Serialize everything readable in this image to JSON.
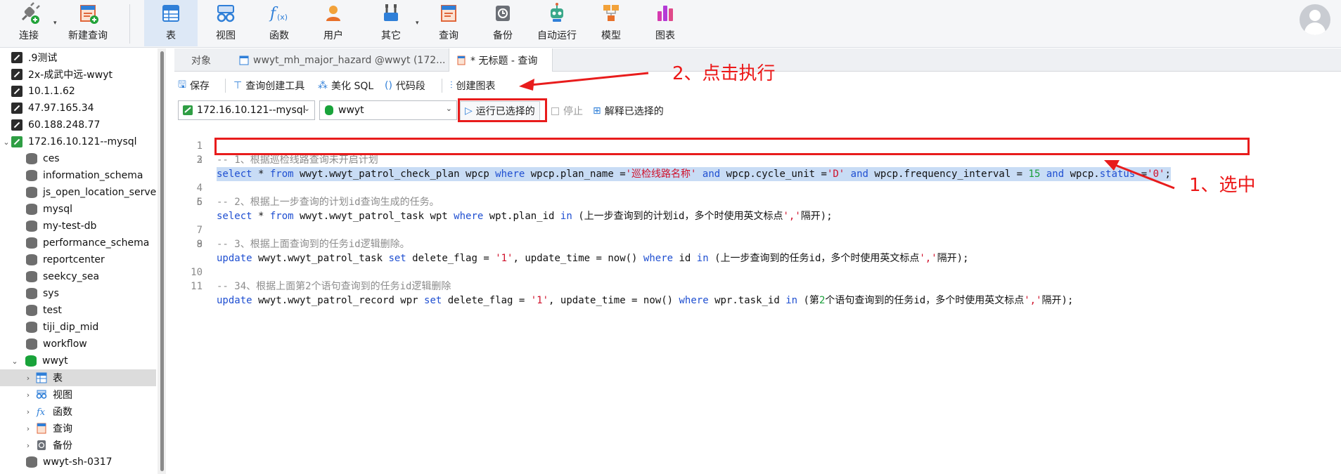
{
  "toolbar": {
    "items": [
      {
        "id": "connect",
        "label": "连接",
        "icon": "plug-icon"
      },
      {
        "id": "new-query",
        "label": "新建查询",
        "icon": "new-query-icon"
      },
      {
        "id": "table",
        "label": "表",
        "icon": "table-icon",
        "active": true
      },
      {
        "id": "view",
        "label": "视图",
        "icon": "glasses-icon"
      },
      {
        "id": "function",
        "label": "函数",
        "icon": "function-icon"
      },
      {
        "id": "user",
        "label": "用户",
        "icon": "user-icon"
      },
      {
        "id": "other",
        "label": "其它",
        "icon": "tools-icon"
      },
      {
        "id": "query",
        "label": "查询",
        "icon": "query-icon"
      },
      {
        "id": "backup",
        "label": "备份",
        "icon": "backup-icon"
      },
      {
        "id": "automation",
        "label": "自动运行",
        "icon": "robot-icon"
      },
      {
        "id": "model",
        "label": "模型",
        "icon": "model-icon"
      },
      {
        "id": "chart",
        "label": "图表",
        "icon": "chart-icon"
      }
    ]
  },
  "sidebar": {
    "items": [
      {
        "label": ".9测试",
        "type": "connection"
      },
      {
        "label": "2x-成武中远-wwyt",
        "type": "connection"
      },
      {
        "label": "10.1.1.62",
        "type": "connection"
      },
      {
        "label": "47.97.165.34",
        "type": "connection"
      },
      {
        "label": "60.188.248.77",
        "type": "connection"
      },
      {
        "label": "172.16.10.121--mysql",
        "type": "connection-open",
        "caret": "⌄"
      },
      {
        "label": "ces",
        "type": "database"
      },
      {
        "label": "information_schema",
        "type": "database"
      },
      {
        "label": "js_open_location_server",
        "type": "database"
      },
      {
        "label": "mysql",
        "type": "database"
      },
      {
        "label": "my-test-db",
        "type": "database"
      },
      {
        "label": "performance_schema",
        "type": "database"
      },
      {
        "label": "reportcenter",
        "type": "database"
      },
      {
        "label": "seekcy_sea",
        "type": "database"
      },
      {
        "label": "sys",
        "type": "database"
      },
      {
        "label": "test",
        "type": "database"
      },
      {
        "label": "tiji_dip_mid",
        "type": "database"
      },
      {
        "label": "workflow",
        "type": "database"
      },
      {
        "label": "wwyt",
        "type": "database-open",
        "caret": "⌄"
      },
      {
        "label": "表",
        "type": "node-table",
        "caret": "›",
        "selected": true
      },
      {
        "label": "视图",
        "type": "node-view",
        "caret": "›"
      },
      {
        "label": "函数",
        "type": "node-function",
        "caret": "›"
      },
      {
        "label": "查询",
        "type": "node-query",
        "caret": "›"
      },
      {
        "label": "备份",
        "type": "node-backup",
        "caret": "›"
      },
      {
        "label": "wwyt-sh-0317",
        "type": "database"
      }
    ]
  },
  "tabs": [
    {
      "label": "对象",
      "active": false
    },
    {
      "label": "wwyt_mh_major_hazard @wwyt (172...",
      "active": false
    },
    {
      "label": "* 无标题 - 查询",
      "active": true
    }
  ],
  "actions": {
    "save": "保存",
    "query_builder": "查询创建工具",
    "beautify": "美化 SQL",
    "snippet": "代码段",
    "create_chart": "创建图表"
  },
  "run_bar": {
    "connection": "172.16.10.121--mysql",
    "database": "wwyt",
    "run_selected": "运行已选择的",
    "stop": "停止",
    "explain_selected": "解释已选择的"
  },
  "editor": {
    "lines": [
      "-- 1、根据巡检线路查询未开启计划",
      "select * from wwyt.wwyt_patrol_check_plan wpcp where wpcp.plan_name ='巡检线路名称' and wpcp.cycle_unit ='D' and wpcp.frequency_interval = 15 and wpcp.status ='0';",
      "",
      "-- 2、根据上一步查询的计划id查询生成的任务。",
      "select * from wwyt.wwyt_patrol_task wpt where wpt.plan_id in (上一步查询到的计划id，多个时使用英文标点','隔开);",
      "",
      "-- 3、根据上面查询到的任务id逻辑删除。",
      "update wwyt.wwyt_patrol_task set delete_flag = '1', update_time = now() where id in (上一步查询到的任务id，多个时使用英文标点','隔开);",
      "",
      "-- 34、根据上面第2个语句查询到的任务id逻辑删除",
      "update wwyt.wwyt_patrol_record wpr set delete_flag = '1', update_time = now() where wpr.task_id in (第2个语句查询到的任务id，多个时使用英文标点','隔开);"
    ]
  },
  "annotations": {
    "select_label": "1、选中",
    "run_label": "2、点击执行",
    "color": "#e81c1c"
  }
}
